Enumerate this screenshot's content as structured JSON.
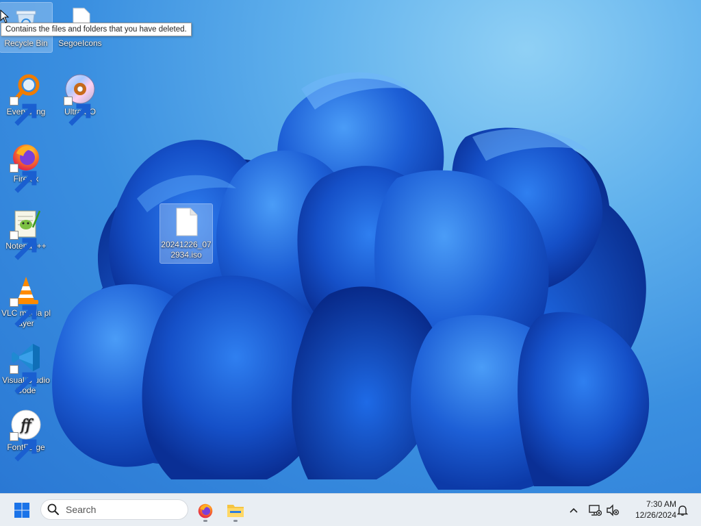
{
  "desktop": {
    "tooltip": "Contains the files and folders that you have deleted.",
    "icons": [
      {
        "label": "Recycle Bin",
        "icon": "recycle-bin-icon"
      },
      {
        "label": "SegoeIcons",
        "icon": "blank-file-icon"
      },
      {
        "label": "Everything",
        "icon": "everything-search-icon"
      },
      {
        "label": "UltraISO",
        "icon": "disc-icon"
      },
      {
        "label": "Firefox",
        "icon": "firefox-icon"
      },
      {
        "label": "Notepad++",
        "icon": "notepad-plus-plus-icon"
      },
      {
        "label": "VLC media player",
        "icon": "vlc-cone-icon"
      },
      {
        "label": "Visual Studio Code",
        "icon": "vscode-icon"
      },
      {
        "label": "FontForge",
        "icon": "fontforge-icon"
      },
      {
        "label": "20241226_072934.iso",
        "icon": "iso-file-icon"
      }
    ]
  },
  "taskbar": {
    "search_placeholder": "Search",
    "apps": [
      {
        "name": "Firefox",
        "icon": "firefox-icon"
      },
      {
        "name": "File Explorer",
        "icon": "folder-icon"
      }
    ],
    "tray": {
      "chevron": "chevron-up-icon",
      "network": "network-disconnected-icon",
      "sound": "speaker-muted-icon",
      "notifications": "bell-icon"
    },
    "clock": {
      "time": "7:30 AM",
      "date": "12/26/2024"
    }
  },
  "colors": {
    "wallpaper_sky": "#5fb0ec",
    "wallpaper_petal": "#1a55d0",
    "taskbar_bg": "#e9eef3",
    "start_blue": "#1a73e8"
  }
}
